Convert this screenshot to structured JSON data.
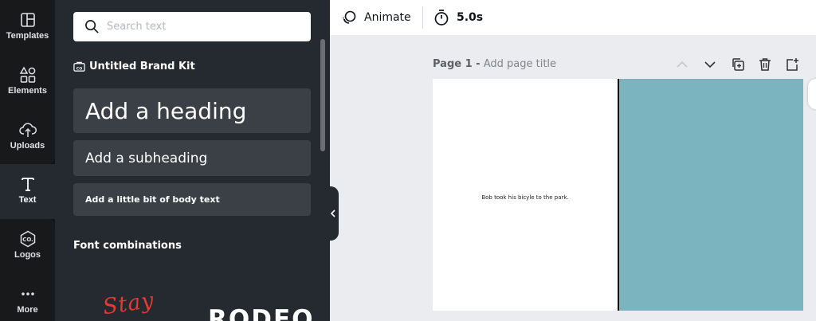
{
  "sidebar": {
    "items": [
      {
        "label": "Templates",
        "icon": "templates-icon"
      },
      {
        "label": "Elements",
        "icon": "elements-icon"
      },
      {
        "label": "Uploads",
        "icon": "upload-cloud-icon"
      },
      {
        "label": "Text",
        "icon": "text-icon",
        "active": true
      },
      {
        "label": "Logos",
        "icon": "logo-icon"
      },
      {
        "label": "More",
        "icon": "more-dots-icon"
      }
    ]
  },
  "panel": {
    "search": {
      "placeholder": "Search text",
      "value": ""
    },
    "brand_kit": "Untitled Brand Kit",
    "heading": "Add a heading",
    "subheading": "Add a subheading",
    "body": "Add a little bit of body text",
    "font_combinations": "Font combinations",
    "preview_1": "Stay",
    "preview_2": "RODEO"
  },
  "topbar": {
    "animate": "Animate",
    "duration": "5.0s"
  },
  "canvas": {
    "page_number": "Page 1 -",
    "page_title_placeholder": "Add page title",
    "caption": "Bob took his bicyle to the park.",
    "colors": {
      "right_half": "#7bb3bf",
      "accent_text": "#e53935"
    }
  }
}
